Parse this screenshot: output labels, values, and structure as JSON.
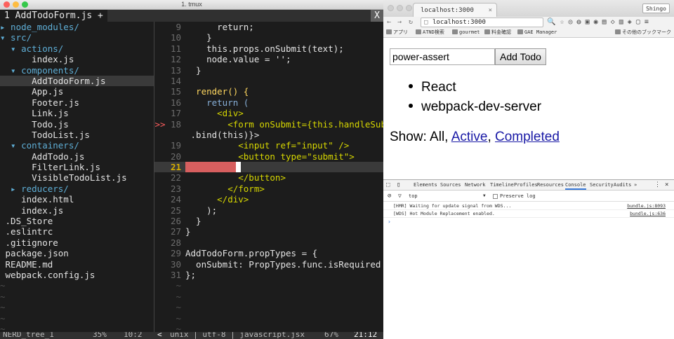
{
  "terminal": {
    "window_title": "1. tmux",
    "tab_label": "1 AddTodoForm.js +",
    "tab_close": "X",
    "tree": [
      {
        "text": "▸ node_modules/",
        "kind": "dir"
      },
      {
        "text": "▾ src/",
        "kind": "dir"
      },
      {
        "text": "  ▾ actions/",
        "kind": "dir"
      },
      {
        "text": "      index.js",
        "kind": "file"
      },
      {
        "text": "  ▾ components/",
        "kind": "dir"
      },
      {
        "text": "      AddTodoForm.js",
        "kind": "sel"
      },
      {
        "text": "      App.js",
        "kind": "file"
      },
      {
        "text": "      Footer.js",
        "kind": "file"
      },
      {
        "text": "      Link.js",
        "kind": "file"
      },
      {
        "text": "      Todo.js",
        "kind": "file"
      },
      {
        "text": "      TodoList.js",
        "kind": "file"
      },
      {
        "text": "  ▾ containers/",
        "kind": "dir"
      },
      {
        "text": "      AddTodo.js",
        "kind": "file"
      },
      {
        "text": "      FilterLink.js",
        "kind": "file"
      },
      {
        "text": "      VisibleTodoList.js",
        "kind": "file"
      },
      {
        "text": "  ▸ reducers/",
        "kind": "dir"
      },
      {
        "text": "    index.html",
        "kind": "file"
      },
      {
        "text": "    index.js",
        "kind": "file"
      },
      {
        "text": " .DS_Store",
        "kind": "file"
      },
      {
        "text": " .eslintrc",
        "kind": "file"
      },
      {
        "text": " .gitignore",
        "kind": "file"
      },
      {
        "text": " package.json",
        "kind": "file"
      },
      {
        "text": " README.md",
        "kind": "file"
      },
      {
        "text": " webpack.config.js",
        "kind": "file"
      },
      {
        "text": "~",
        "kind": "tilde"
      },
      {
        "text": "~",
        "kind": "tilde"
      },
      {
        "text": "~",
        "kind": "tilde"
      },
      {
        "text": "~",
        "kind": "tilde"
      },
      {
        "text": "~",
        "kind": "tilde"
      }
    ],
    "code": [
      {
        "n": "9",
        "sign": "",
        "t": "      return;",
        "c": "code"
      },
      {
        "n": "10",
        "sign": "",
        "t": "    }",
        "c": "code"
      },
      {
        "n": "11",
        "sign": "",
        "t": "    this.props.onSubmit(text);",
        "c": "code"
      },
      {
        "n": "12",
        "sign": "",
        "t": "    node.value = '';",
        "c": "code"
      },
      {
        "n": "13",
        "sign": "",
        "t": "  }",
        "c": "code"
      },
      {
        "n": "14",
        "sign": "",
        "t": "",
        "c": "code"
      },
      {
        "n": "15",
        "sign": "",
        "t": "  render() {",
        "c": "fn"
      },
      {
        "n": "16",
        "sign": "",
        "t": "    return (",
        "c": "kw"
      },
      {
        "n": "17",
        "sign": "",
        "t": "      <div>",
        "c": "tag"
      },
      {
        "n": "18",
        "sign": ">>",
        "t": "        <form onSubmit={this.handleSubmit",
        "c": "tag"
      },
      {
        "n": "",
        "sign": "",
        "t": " .bind(this)}>",
        "c": "code"
      },
      {
        "n": "19",
        "sign": "",
        "t": "          <input ref=\"input\" />",
        "c": "tag"
      },
      {
        "n": "20",
        "sign": "",
        "t": "          <button type=\"submit\">",
        "c": "tag"
      },
      {
        "n": "21",
        "sign": "",
        "t": "",
        "c": "current"
      },
      {
        "n": "22",
        "sign": "",
        "t": "          </button>",
        "c": "tag"
      },
      {
        "n": "23",
        "sign": "",
        "t": "        </form>",
        "c": "tag"
      },
      {
        "n": "24",
        "sign": "",
        "t": "      </div>",
        "c": "tag"
      },
      {
        "n": "25",
        "sign": "",
        "t": "    );",
        "c": "code"
      },
      {
        "n": "26",
        "sign": "",
        "t": "  }",
        "c": "code"
      },
      {
        "n": "27",
        "sign": "",
        "t": "}",
        "c": "code"
      },
      {
        "n": "28",
        "sign": "",
        "t": "",
        "c": "code"
      },
      {
        "n": "29",
        "sign": "",
        "t": "AddTodoForm.propTypes = {",
        "c": "code"
      },
      {
        "n": "30",
        "sign": "",
        "t": "  onSubmit: PropTypes.func.isRequired",
        "c": "code"
      },
      {
        "n": "31",
        "sign": "",
        "t": "};",
        "c": "code"
      },
      {
        "n": "~",
        "sign": "",
        "t": "",
        "c": "tilde"
      },
      {
        "n": "~",
        "sign": "",
        "t": "",
        "c": "tilde"
      },
      {
        "n": "~",
        "sign": "",
        "t": "",
        "c": "tilde"
      },
      {
        "n": "~",
        "sign": "",
        "t": "",
        "c": "tilde"
      },
      {
        "n": "~",
        "sign": "",
        "t": "",
        "c": "tilde"
      }
    ],
    "status": {
      "tree_name": "NERD_tree_1",
      "tree_pct": "35%",
      "tree_pos": "10:2",
      "mode": "<",
      "format": "unix | utf-8 | javascript.jsx",
      "pct": "67%",
      "pos": "21:12"
    }
  },
  "browser": {
    "tab_title": "localhost:3000",
    "tab_close": "×",
    "user": "Shingo",
    "url": "localhost:3000",
    "bookmarks": [
      "アプリ",
      "ATND検索",
      "gourmet",
      "料金確認",
      "GAE Manager",
      "その他のブックマーク"
    ],
    "page": {
      "input_value": "power-assert",
      "add_button": "Add Todo",
      "todos": [
        "React",
        "webpack-dev-server"
      ],
      "show_label": "Show:",
      "filter_all": "All",
      "sep1": ",",
      "filter_active": "Active",
      "sep2": ",",
      "filter_completed": "Completed"
    },
    "devtools": {
      "tabs": [
        "Elements",
        "Sources",
        "Network",
        "Timeline",
        "Profiles",
        "Resources",
        "Console",
        "Security",
        "Audits",
        "»"
      ],
      "active_tab": "Console",
      "context": "top",
      "preserve_log": "Preserve log",
      "logs": [
        {
          "msg": "[HMR] Waiting for update signal from WDS...",
          "src": "bundle.js:8093"
        },
        {
          "msg": "[WDS] Hot Module Replacement enabled.",
          "src": "bundle.js:636"
        }
      ],
      "prompt": "›"
    }
  },
  "colors": {
    "terminal_bg": "#1c1c1c",
    "error_red": "#d75f5f",
    "link_blue": "#1a1aa6",
    "devtools_accent": "#3879d9"
  }
}
